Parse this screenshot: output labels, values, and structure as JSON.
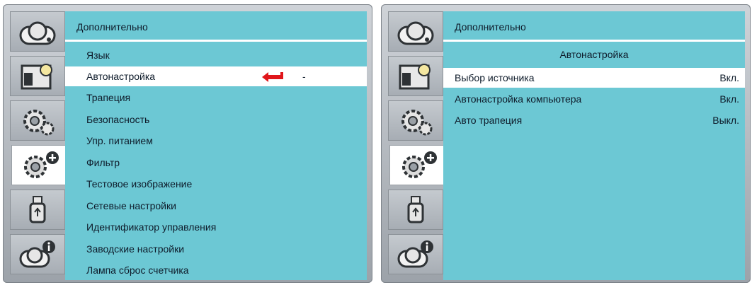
{
  "left_panel": {
    "title": "Дополнительно",
    "items": [
      {
        "label": "Язык"
      },
      {
        "label": "Автонастройка"
      },
      {
        "label": "Трапеция"
      },
      {
        "label": "Безопасность"
      },
      {
        "label": "Упр. питанием"
      },
      {
        "label": "Фильтр"
      },
      {
        "label": "Тестовое изображение"
      },
      {
        "label": "Сетевые настройки"
      },
      {
        "label": "Идентификатор управления"
      },
      {
        "label": "Заводские настройки"
      },
      {
        "label": "Лампа сброс счетчика"
      }
    ],
    "selected_index": 1,
    "selected_marker": "-",
    "arrow_color": "#e0161b"
  },
  "right_panel": {
    "title": "Дополнительно",
    "subtitle": "Автонастройка",
    "items": [
      {
        "label": "Выбор источника",
        "value": "Вкл."
      },
      {
        "label": "Автонастройка компьютера",
        "value": "Вкл."
      },
      {
        "label": "Авто трапеция",
        "value": "Выкл."
      }
    ],
    "selected_index": 0
  },
  "sidebar": {
    "icons": [
      "projector-icon",
      "brightness-icon",
      "gear-icon",
      "advanced-gear-icon",
      "usb-icon",
      "info-projector-icon"
    ],
    "active_index": 3
  },
  "colors": {
    "content_bg": "#6cc8d4",
    "selected_row": "#ffffff"
  }
}
